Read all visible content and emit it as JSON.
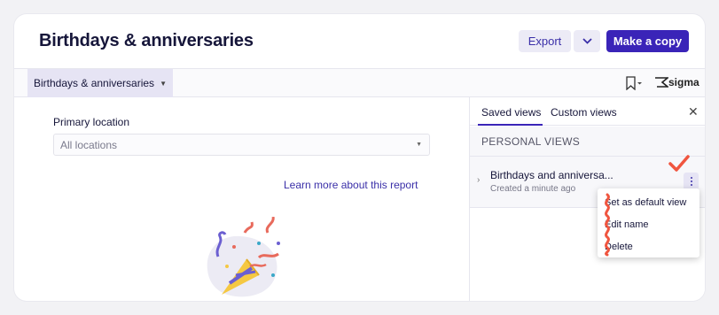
{
  "header": {
    "title": "Birthdays & anniversaries",
    "export_label": "Export",
    "make_copy_label": "Make a copy"
  },
  "toolbar": {
    "page_tab_label": "Birthdays & anniversaries",
    "brand": "sigma"
  },
  "filter": {
    "label": "Primary location",
    "value": "All locations"
  },
  "links": {
    "learn_more": "Learn more about this report"
  },
  "panel": {
    "tabs": [
      "Saved views",
      "Custom views"
    ],
    "active_tab": "Saved views",
    "section_title": "PERSONAL VIEWS",
    "views": [
      {
        "name": "Birthdays and anniversa...",
        "meta": "Created a minute ago"
      }
    ]
  },
  "context_menu": {
    "items": [
      "Set as default view",
      "Edit name",
      "Delete"
    ]
  },
  "colors": {
    "accent": "#3a24b8",
    "annotation": "#f0553f"
  }
}
